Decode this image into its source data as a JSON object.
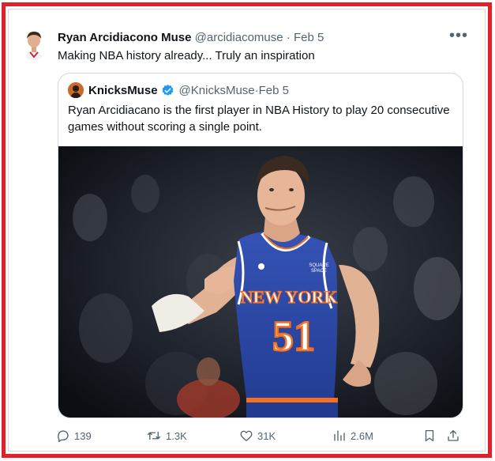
{
  "tweet": {
    "display_name": "Ryan Arcidiacono Muse",
    "handle": "@arcidiacomuse",
    "separator": "·",
    "date": "Feb 5",
    "text": "Making NBA history already... Truly an inspiration",
    "more_icon": "more-horizontal-icon"
  },
  "quote": {
    "display_name": "KnicksMuse",
    "verified_icon": "verified-badge-icon",
    "verified_color": "#1d9bf0",
    "handle": "@KnicksMuse",
    "separator": "·",
    "date": "Feb 5",
    "text": "Ryan Arcidiacano is the first player in NBA History to play 20 consecutive games without scoring a single point.",
    "image": {
      "jersey_text": "NEW YORK",
      "jersey_number": "51",
      "sponsor_line1": "SQUARE",
      "sponsor_line2": "SPACE",
      "jersey_color": "#2c48a5"
    }
  },
  "actions": {
    "replies": "139",
    "reposts": "1.3K",
    "likes": "31K",
    "views": "2.6M"
  },
  "colors": {
    "frame_border": "#e0212b",
    "secondary_text": "#536471"
  }
}
